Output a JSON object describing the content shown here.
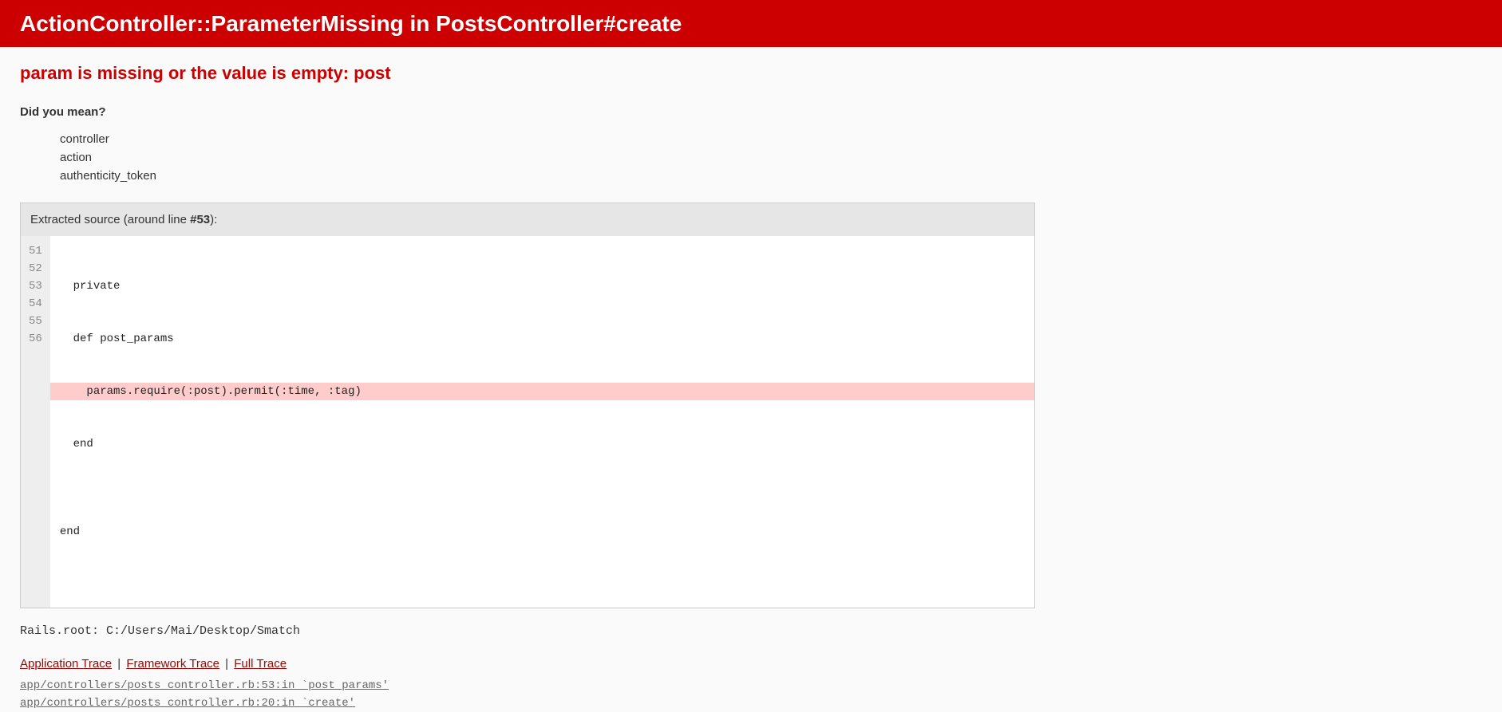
{
  "header": {
    "title": "ActionController::ParameterMissing in PostsController#create"
  },
  "error": {
    "message": "param is missing or the value is empty: post"
  },
  "did_you_mean": {
    "label": "Did you mean?",
    "suggestions": [
      "controller",
      "action",
      "authenticity_token"
    ]
  },
  "source": {
    "header_prefix": "Extracted source (around line ",
    "header_line": "#53",
    "header_suffix": "):",
    "highlight_line": 53,
    "lines": [
      {
        "num": "51",
        "code": "  private"
      },
      {
        "num": "52",
        "code": "  def post_params"
      },
      {
        "num": "53",
        "code": "    params.require(:post).permit(:time, :tag)"
      },
      {
        "num": "54",
        "code": "  end"
      },
      {
        "num": "55",
        "code": ""
      },
      {
        "num": "56",
        "code": "end"
      }
    ]
  },
  "rails_root": "Rails.root: C:/Users/Mai/Desktop/Smatch",
  "trace_tabs": {
    "application": "Application Trace",
    "framework": "Framework Trace",
    "full": "Full Trace"
  },
  "trace_entries": [
    "app/controllers/posts_controller.rb:53:in `post_params'",
    "app/controllers/posts_controller.rb:20:in `create'"
  ]
}
